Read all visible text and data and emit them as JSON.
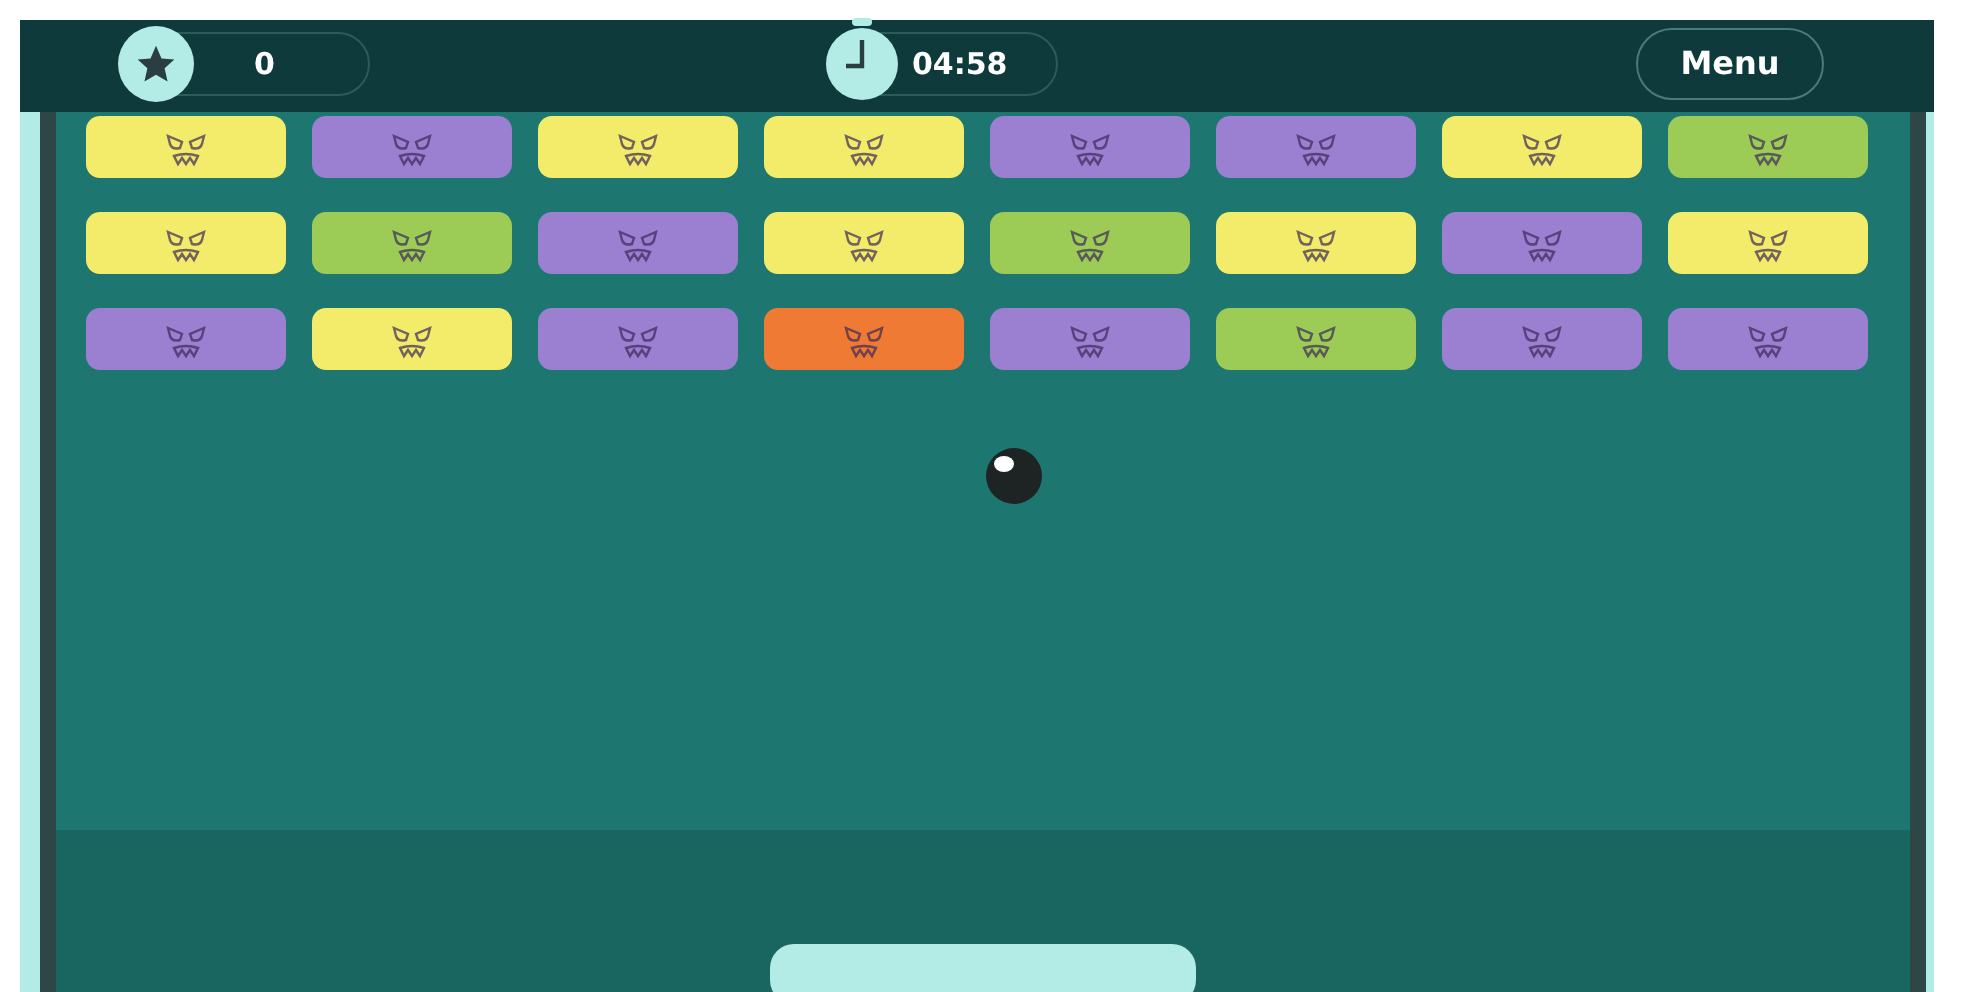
{
  "hud": {
    "score": "0",
    "timer": "04:58",
    "menu": "Menu"
  },
  "bricks": [
    [
      {
        "color": "#f2ec6a"
      },
      {
        "color": "#9b7fd0"
      },
      {
        "color": "#f2ec6a"
      },
      {
        "color": "#f2ec6a"
      },
      {
        "color": "#9b7fd0"
      },
      {
        "color": "#9b7fd0"
      },
      {
        "color": "#f2ec6a"
      },
      {
        "color": "#9ccc55"
      }
    ],
    [
      {
        "color": "#f2ec6a"
      },
      {
        "color": "#9ccc55"
      },
      {
        "color": "#9b7fd0"
      },
      {
        "color": "#f2ec6a"
      },
      {
        "color": "#9ccc55"
      },
      {
        "color": "#f2ec6a"
      },
      {
        "color": "#9b7fd0"
      },
      {
        "color": "#f2ec6a"
      }
    ],
    [
      {
        "color": "#9b7fd0"
      },
      {
        "color": "#f2ec6a"
      },
      {
        "color": "#9b7fd0"
      },
      {
        "color": "#ee7a33"
      },
      {
        "color": "#9b7fd0"
      },
      {
        "color": "#9ccc55"
      },
      {
        "color": "#9b7fd0"
      },
      {
        "color": "#9b7fd0"
      }
    ]
  ]
}
